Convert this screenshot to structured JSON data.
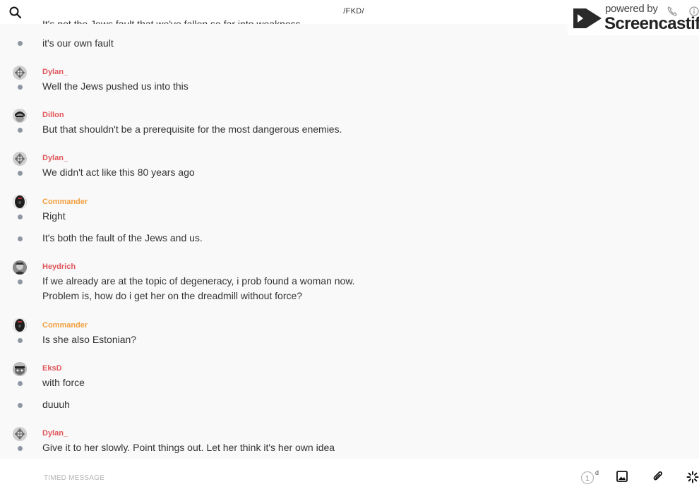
{
  "header": {
    "channel": "/FKD/",
    "cut_off_text": "It's not the Jews fault that we've fallen so far into weakness"
  },
  "watermark": {
    "powered": "powered by",
    "brand": "Screencastify"
  },
  "messages": [
    {
      "text": "it's our own fault"
    },
    {
      "author": "Dylan_",
      "text": "Well the Jews pushed us into this"
    },
    {
      "author": "Dillon",
      "text": "But that shouldn't be a prerequisite for the most dangerous enemies."
    },
    {
      "author": "Dylan_",
      "text": "We didn't act like this 80 years ago"
    },
    {
      "author": "Commander",
      "text": "Right"
    },
    {
      "text": "It's both the fault of the Jews and us."
    },
    {
      "author": "Heydrich",
      "text": "If we already are at the topic of degeneracy, i prob found a woman now.",
      "text2": "Problem is, how do i get her on the dreadmill without force?"
    },
    {
      "author": "Commander",
      "text": "Is she also Estonian?"
    },
    {
      "author": "EksD",
      "text": "with force"
    },
    {
      "text": "duuuh"
    },
    {
      "author": "Dylan_",
      "text": "Give it to her slowly. Point things out. Let her think it's her own idea"
    }
  ],
  "composer": {
    "placeholder": "TIMED MESSAGE",
    "timer_value": "1",
    "timer_unit": "d"
  },
  "colors": {
    "author_red": "#e0575b",
    "author_orange": "#f0a040",
    "bullet": "#8e96a2"
  }
}
